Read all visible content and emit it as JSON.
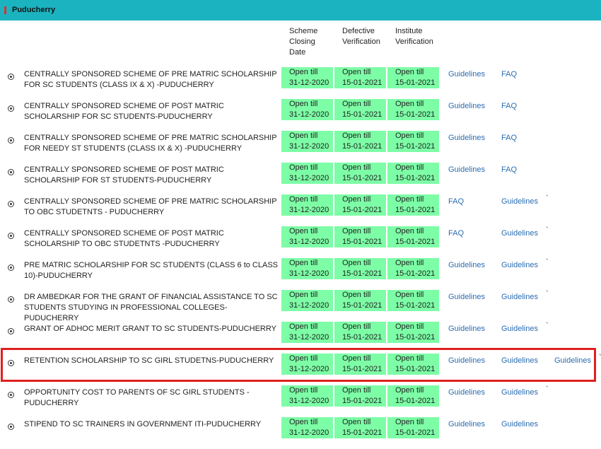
{
  "header": {
    "title": "Puducherry"
  },
  "columns": {
    "closing": [
      "Scheme",
      "Closing",
      "Date"
    ],
    "defective": [
      "Defective",
      "Verification"
    ],
    "institute": [
      "Institute",
      "Verification"
    ]
  },
  "rows": [
    {
      "name": "CENTRALLY SPONSORED SCHEME OF PRE MATRIC SCHOLARSHIP FOR SC STUDENTS (CLASS IX & X) -PUDUCHERRY",
      "closing": [
        "Open till",
        "31-12-2020"
      ],
      "defective": [
        "Open till",
        "15-01-2021"
      ],
      "institute": [
        "Open till",
        "15-01-2021"
      ],
      "links": [
        "Guidelines",
        "FAQ"
      ],
      "tick": ""
    },
    {
      "name": "CENTRALLY SPONSORED SCHEME OF POST MATRIC SCHOLARSHIP FOR SC STUDENTS-PUDUCHERRY",
      "closing": [
        "Open till",
        "31-12-2020"
      ],
      "defective": [
        "Open till",
        "15-01-2021"
      ],
      "institute": [
        "Open till",
        "15-01-2021"
      ],
      "links": [
        "Guidelines",
        "FAQ"
      ],
      "tick": ""
    },
    {
      "name": "CENTRALLY SPONSORED SCHEME OF PRE MATRIC SCHOLARSHIP FOR NEEDY ST STUDENTS (CLASS IX & X) -PUDUCHERRY",
      "closing": [
        "Open till",
        "31-12-2020"
      ],
      "defective": [
        "Open till",
        "15-01-2021"
      ],
      "institute": [
        "Open till",
        "15-01-2021"
      ],
      "links": [
        "Guidelines",
        "FAQ"
      ],
      "tick": ""
    },
    {
      "name": "CENTRALLY SPONSORED SCHEME OF POST MATRIC SCHOLARSHIP FOR ST STUDENTS-PUDUCHERRY",
      "closing": [
        "Open till",
        "31-12-2020"
      ],
      "defective": [
        "Open till",
        "15-01-2021"
      ],
      "institute": [
        "Open till",
        "15-01-2021"
      ],
      "links": [
        "Guidelines",
        "FAQ"
      ],
      "tick": ""
    },
    {
      "name": "CENTRALLY SPONSORED SCHEME OF PRE MATRIC SCHOLARSHIP TO OBC STUDETNTS - PUDUCHERRY",
      "closing": [
        "Open till",
        "31-12-2020"
      ],
      "defective": [
        "Open till",
        "15-01-2021"
      ],
      "institute": [
        "Open till",
        "15-01-2021"
      ],
      "links": [
        "FAQ",
        "Guidelines"
      ],
      "tick": "`"
    },
    {
      "name": "CENTRALLY SPONSORED SCHEME OF POST MATRIC SCHOLARSHIP TO OBC STUDETNTS -PUDUCHERRY",
      "closing": [
        "Open till",
        "31-12-2020"
      ],
      "defective": [
        "Open till",
        "15-01-2021"
      ],
      "institute": [
        "Open till",
        "15-01-2021"
      ],
      "links": [
        "FAQ",
        "Guidelines"
      ],
      "tick": "`"
    },
    {
      "name": "PRE MATRIC SCHOLARSHIP FOR SC STUDENTS (CLASS 6 to CLASS 10)-PUDUCHERRY",
      "closing": [
        "Open till",
        "31-12-2020"
      ],
      "defective": [
        "Open till",
        "15-01-2021"
      ],
      "institute": [
        "Open till",
        "15-01-2021"
      ],
      "links": [
        "Guidelines",
        "Guidelines"
      ],
      "tick": "`"
    },
    {
      "name": "DR AMBEDKAR FOR THE GRANT OF FINANCIAL ASSISTANCE TO SC STUDENTS STUDYING IN PROFESSIONAL COLLEGES-PUDUCHERRY",
      "closing": [
        "Open till",
        "31-12-2020"
      ],
      "defective": [
        "Open till",
        "15-01-2021"
      ],
      "institute": [
        "Open till",
        "15-01-2021"
      ],
      "links": [
        "Guidelines",
        "Guidelines"
      ],
      "tick": "`"
    },
    {
      "name": "GRANT OF ADHOC MERIT GRANT TO SC STUDENTS-PUDUCHERRY",
      "closing": [
        "Open till",
        "31-12-2020"
      ],
      "defective": [
        "Open till",
        "15-01-2021"
      ],
      "institute": [
        "Open till",
        "15-01-2021"
      ],
      "links": [
        "Guidelines",
        "Guidelines"
      ],
      "tick": "`"
    },
    {
      "name": "RETENTION SCHOLARSHIP TO SC GIRL STUDETNS-PUDUCHERRY",
      "closing": [
        "Open till",
        "31-12-2020"
      ],
      "defective": [
        "Open till",
        "15-01-2021"
      ],
      "institute": [
        "Open till",
        "15-01-2021"
      ],
      "links": [
        "Guidelines",
        "Guidelines",
        "Guidelines"
      ],
      "tick": "`"
    },
    {
      "name": "OPPORTUNITY COST TO PARENTS OF SC GIRL STUDENTS - PUDUCHERRY",
      "closing": [
        "Open till",
        "31-12-2020"
      ],
      "defective": [
        "Open till",
        "15-01-2021"
      ],
      "institute": [
        "Open till",
        "15-01-2021"
      ],
      "links": [
        "Guidelines",
        "Guidelines"
      ],
      "tick": "`"
    },
    {
      "name": "STIPEND TO SC TRAINERS IN GOVERNMENT ITI-PUDUCHERRY",
      "closing": [
        "Open till",
        "31-12-2020"
      ],
      "defective": [
        "Open till",
        "15-01-2021"
      ],
      "institute": [
        "Open till",
        "15-01-2021"
      ],
      "links": [
        "Guidelines",
        "Guidelines"
      ],
      "tick": ""
    }
  ]
}
